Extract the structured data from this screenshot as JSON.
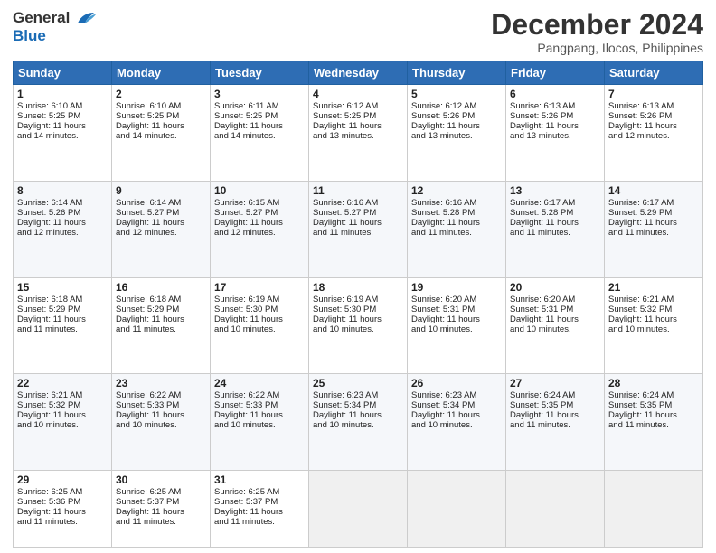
{
  "logo": {
    "line1": "General",
    "line2": "Blue"
  },
  "header": {
    "month": "December 2024",
    "location": "Pangpang, Ilocos, Philippines"
  },
  "weekdays": [
    "Sunday",
    "Monday",
    "Tuesday",
    "Wednesday",
    "Thursday",
    "Friday",
    "Saturday"
  ],
  "weeks": [
    [
      {
        "day": 1,
        "lines": [
          "Sunrise: 6:10 AM",
          "Sunset: 5:25 PM",
          "Daylight: 11 hours",
          "and 14 minutes."
        ]
      },
      {
        "day": 2,
        "lines": [
          "Sunrise: 6:10 AM",
          "Sunset: 5:25 PM",
          "Daylight: 11 hours",
          "and 14 minutes."
        ]
      },
      {
        "day": 3,
        "lines": [
          "Sunrise: 6:11 AM",
          "Sunset: 5:25 PM",
          "Daylight: 11 hours",
          "and 14 minutes."
        ]
      },
      {
        "day": 4,
        "lines": [
          "Sunrise: 6:12 AM",
          "Sunset: 5:25 PM",
          "Daylight: 11 hours",
          "and 13 minutes."
        ]
      },
      {
        "day": 5,
        "lines": [
          "Sunrise: 6:12 AM",
          "Sunset: 5:26 PM",
          "Daylight: 11 hours",
          "and 13 minutes."
        ]
      },
      {
        "day": 6,
        "lines": [
          "Sunrise: 6:13 AM",
          "Sunset: 5:26 PM",
          "Daylight: 11 hours",
          "and 13 minutes."
        ]
      },
      {
        "day": 7,
        "lines": [
          "Sunrise: 6:13 AM",
          "Sunset: 5:26 PM",
          "Daylight: 11 hours",
          "and 12 minutes."
        ]
      }
    ],
    [
      {
        "day": 8,
        "lines": [
          "Sunrise: 6:14 AM",
          "Sunset: 5:26 PM",
          "Daylight: 11 hours",
          "and 12 minutes."
        ]
      },
      {
        "day": 9,
        "lines": [
          "Sunrise: 6:14 AM",
          "Sunset: 5:27 PM",
          "Daylight: 11 hours",
          "and 12 minutes."
        ]
      },
      {
        "day": 10,
        "lines": [
          "Sunrise: 6:15 AM",
          "Sunset: 5:27 PM",
          "Daylight: 11 hours",
          "and 12 minutes."
        ]
      },
      {
        "day": 11,
        "lines": [
          "Sunrise: 6:16 AM",
          "Sunset: 5:27 PM",
          "Daylight: 11 hours",
          "and 11 minutes."
        ]
      },
      {
        "day": 12,
        "lines": [
          "Sunrise: 6:16 AM",
          "Sunset: 5:28 PM",
          "Daylight: 11 hours",
          "and 11 minutes."
        ]
      },
      {
        "day": 13,
        "lines": [
          "Sunrise: 6:17 AM",
          "Sunset: 5:28 PM",
          "Daylight: 11 hours",
          "and 11 minutes."
        ]
      },
      {
        "day": 14,
        "lines": [
          "Sunrise: 6:17 AM",
          "Sunset: 5:29 PM",
          "Daylight: 11 hours",
          "and 11 minutes."
        ]
      }
    ],
    [
      {
        "day": 15,
        "lines": [
          "Sunrise: 6:18 AM",
          "Sunset: 5:29 PM",
          "Daylight: 11 hours",
          "and 11 minutes."
        ]
      },
      {
        "day": 16,
        "lines": [
          "Sunrise: 6:18 AM",
          "Sunset: 5:29 PM",
          "Daylight: 11 hours",
          "and 11 minutes."
        ]
      },
      {
        "day": 17,
        "lines": [
          "Sunrise: 6:19 AM",
          "Sunset: 5:30 PM",
          "Daylight: 11 hours",
          "and 10 minutes."
        ]
      },
      {
        "day": 18,
        "lines": [
          "Sunrise: 6:19 AM",
          "Sunset: 5:30 PM",
          "Daylight: 11 hours",
          "and 10 minutes."
        ]
      },
      {
        "day": 19,
        "lines": [
          "Sunrise: 6:20 AM",
          "Sunset: 5:31 PM",
          "Daylight: 11 hours",
          "and 10 minutes."
        ]
      },
      {
        "day": 20,
        "lines": [
          "Sunrise: 6:20 AM",
          "Sunset: 5:31 PM",
          "Daylight: 11 hours",
          "and 10 minutes."
        ]
      },
      {
        "day": 21,
        "lines": [
          "Sunrise: 6:21 AM",
          "Sunset: 5:32 PM",
          "Daylight: 11 hours",
          "and 10 minutes."
        ]
      }
    ],
    [
      {
        "day": 22,
        "lines": [
          "Sunrise: 6:21 AM",
          "Sunset: 5:32 PM",
          "Daylight: 11 hours",
          "and 10 minutes."
        ]
      },
      {
        "day": 23,
        "lines": [
          "Sunrise: 6:22 AM",
          "Sunset: 5:33 PM",
          "Daylight: 11 hours",
          "and 10 minutes."
        ]
      },
      {
        "day": 24,
        "lines": [
          "Sunrise: 6:22 AM",
          "Sunset: 5:33 PM",
          "Daylight: 11 hours",
          "and 10 minutes."
        ]
      },
      {
        "day": 25,
        "lines": [
          "Sunrise: 6:23 AM",
          "Sunset: 5:34 PM",
          "Daylight: 11 hours",
          "and 10 minutes."
        ]
      },
      {
        "day": 26,
        "lines": [
          "Sunrise: 6:23 AM",
          "Sunset: 5:34 PM",
          "Daylight: 11 hours",
          "and 10 minutes."
        ]
      },
      {
        "day": 27,
        "lines": [
          "Sunrise: 6:24 AM",
          "Sunset: 5:35 PM",
          "Daylight: 11 hours",
          "and 11 minutes."
        ]
      },
      {
        "day": 28,
        "lines": [
          "Sunrise: 6:24 AM",
          "Sunset: 5:35 PM",
          "Daylight: 11 hours",
          "and 11 minutes."
        ]
      }
    ],
    [
      {
        "day": 29,
        "lines": [
          "Sunrise: 6:25 AM",
          "Sunset: 5:36 PM",
          "Daylight: 11 hours",
          "and 11 minutes."
        ]
      },
      {
        "day": 30,
        "lines": [
          "Sunrise: 6:25 AM",
          "Sunset: 5:37 PM",
          "Daylight: 11 hours",
          "and 11 minutes."
        ]
      },
      {
        "day": 31,
        "lines": [
          "Sunrise: 6:25 AM",
          "Sunset: 5:37 PM",
          "Daylight: 11 hours",
          "and 11 minutes."
        ]
      },
      null,
      null,
      null,
      null
    ]
  ]
}
